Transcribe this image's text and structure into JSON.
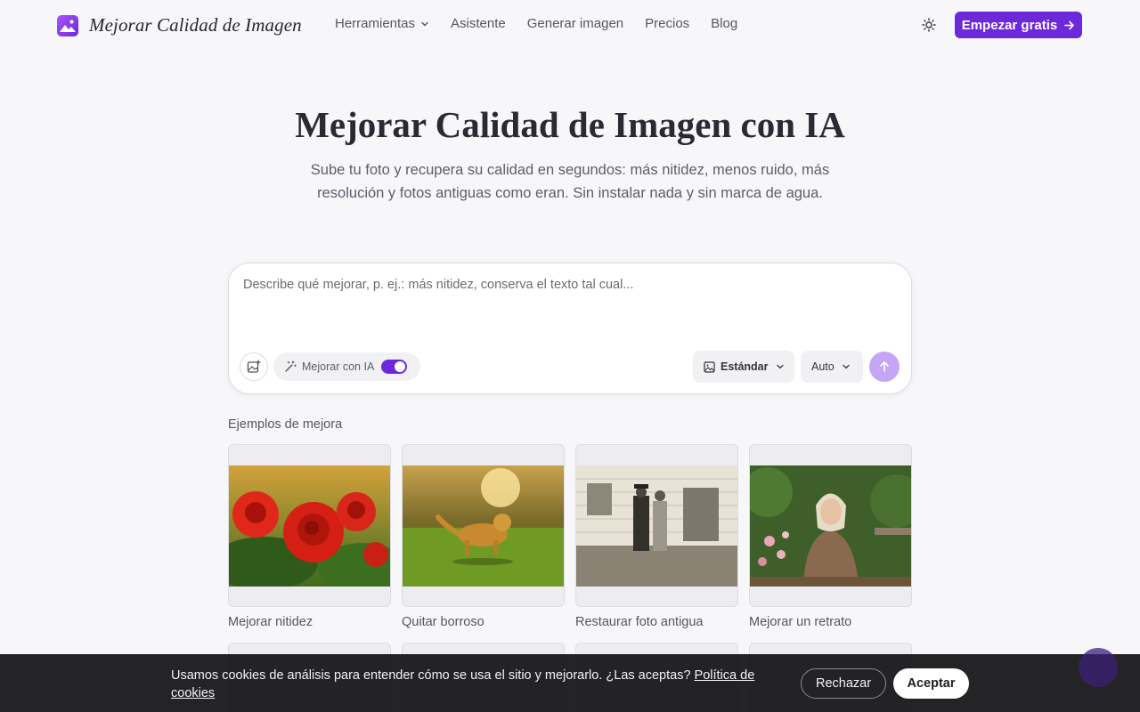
{
  "brand": {
    "name": "Mejorar Calidad de Imagen"
  },
  "nav": {
    "tools": "Herramientas",
    "assistant": "Asistente",
    "generate": "Generar imagen",
    "pricing": "Precios",
    "blog": "Blog",
    "cta": "Empezar gratis"
  },
  "hero": {
    "title": "Mejorar Calidad de Imagen con IA",
    "subtitle": "Sube tu foto y recupera su calidad en segundos: más nitidez, menos ruido, más resolución y fotos antiguas como eran. Sin instalar nada y sin marca de agua."
  },
  "prompt": {
    "placeholder": "Describe qué mejorar, p. ej.: más nitidez, conserva el texto tal cual...",
    "enhance_label": "Mejorar con IA",
    "enhance_on": true,
    "quality": "Estándar",
    "mode": "Auto"
  },
  "examples": {
    "heading": "Ejemplos de mejora",
    "items": [
      {
        "label": "Mejorar nitidez",
        "icon": "roses-photo"
      },
      {
        "label": "Quitar borroso",
        "icon": "dog-photo"
      },
      {
        "label": "Restaurar foto antigua",
        "icon": "old-couple-photo"
      },
      {
        "label": "Mejorar un retrato",
        "icon": "portrait-photo"
      }
    ]
  },
  "cookie": {
    "text": "Usamos cookies de análisis para entender cómo se usa el sitio y mejorarlo. ¿Las aceptas?",
    "link": "Política de cookies",
    "reject": "Rechazar",
    "accept": "Aceptar"
  },
  "colors": {
    "accent": "#6d28d9",
    "accent_light": "#c4a6f5",
    "background": "#f7f7fa"
  }
}
